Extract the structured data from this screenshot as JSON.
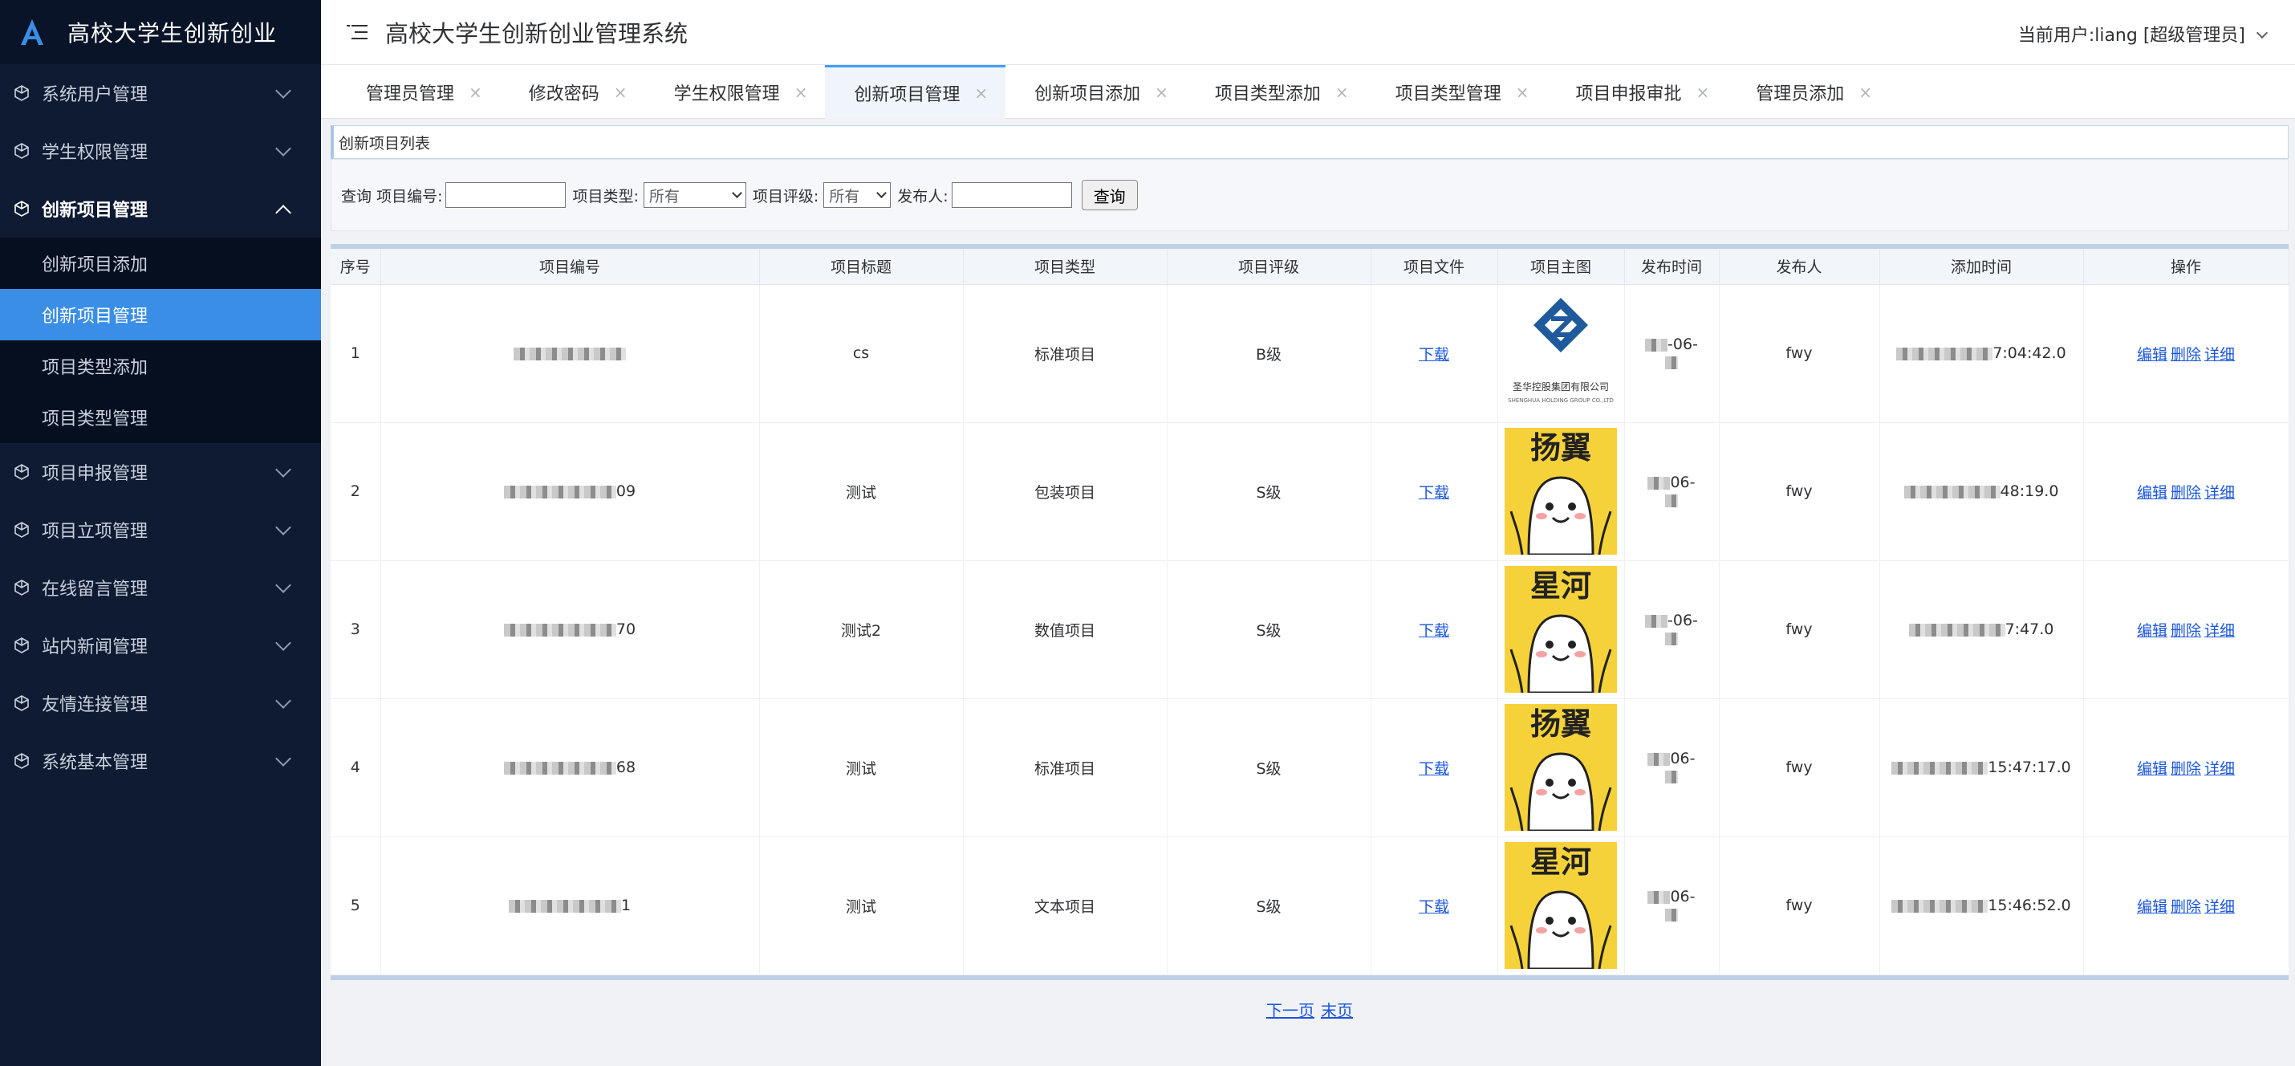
{
  "app": {
    "title": "高校大学生创新创业",
    "system_title": "高校大学生创新创业管理系统"
  },
  "user": {
    "label": "当前用户:liang [超级管理员]"
  },
  "sidebar": {
    "items": [
      {
        "label": "系统用户管理"
      },
      {
        "label": "学生权限管理"
      },
      {
        "label": "创新项目管理",
        "open": true,
        "children": [
          {
            "label": "创新项目添加"
          },
          {
            "label": "创新项目管理",
            "active": true
          },
          {
            "label": "项目类型添加"
          },
          {
            "label": "项目类型管理"
          }
        ]
      },
      {
        "label": "项目申报管理"
      },
      {
        "label": "项目立项管理"
      },
      {
        "label": "在线留言管理"
      },
      {
        "label": "站内新闻管理"
      },
      {
        "label": "友情连接管理"
      },
      {
        "label": "系统基本管理"
      }
    ]
  },
  "tabs": [
    {
      "label": "管理员管理"
    },
    {
      "label": "修改密码"
    },
    {
      "label": "学生权限管理"
    },
    {
      "label": "创新项目管理",
      "active": true
    },
    {
      "label": "创新项目添加"
    },
    {
      "label": "项目类型添加"
    },
    {
      "label": "项目类型管理"
    },
    {
      "label": "项目申报审批"
    },
    {
      "label": "管理员添加"
    }
  ],
  "tab_close": "×",
  "panel": {
    "title": "创新项目列表"
  },
  "search": {
    "prefix": "查询",
    "code_label": "项目编号:",
    "type_label": "项目类型:",
    "type_value": "所有",
    "grade_label": "项目评级:",
    "grade_value": "所有",
    "publisher_label": "发布人:",
    "button": "查询"
  },
  "table": {
    "headers": [
      "序号",
      "项目编号",
      "项目标题",
      "项目类型",
      "项目评级",
      "项目文件",
      "项目主图",
      "发布时间",
      "发布人",
      "添加时间",
      "操作"
    ],
    "rows": [
      {
        "no": "1",
        "code_tail": "",
        "title": "cs",
        "type": "标准项目",
        "grade": "B级",
        "file": "下载",
        "image": "logo",
        "pub_date": "-06-",
        "publisher": "fwy",
        "added_tail": "7:04:42.0"
      },
      {
        "no": "2",
        "code_tail": "09",
        "title": "测试",
        "type": "包装项目",
        "grade": "S级",
        "file": "下载",
        "image": "扬翼",
        "pub_date": "06-",
        "publisher": "fwy",
        "added_tail": "48:19.0"
      },
      {
        "no": "3",
        "code_tail": "70",
        "title": "测试2",
        "type": "数值项目",
        "grade": "S级",
        "file": "下载",
        "image": "星河",
        "pub_date": "-06-",
        "publisher": "fwy",
        "added_tail": "7:47.0"
      },
      {
        "no": "4",
        "code_tail": "68",
        "title": "测试",
        "type": "标准项目",
        "grade": "S级",
        "file": "下载",
        "image": "扬翼",
        "pub_date": "06-",
        "publisher": "fwy",
        "added_tail": "15:47:17.0"
      },
      {
        "no": "5",
        "code_tail": "1",
        "title": "测试",
        "type": "文本项目",
        "grade": "S级",
        "file": "下载",
        "image": "星河",
        "pub_date": "06-",
        "publisher": "fwy",
        "added_tail": "15:46:52.0"
      }
    ],
    "ops": {
      "edit": "编辑",
      "delete": "删除",
      "detail": "详细"
    }
  },
  "logo_caption": "圣华控股集团有限公司",
  "pager": {
    "next": "下一页",
    "last": "末页"
  },
  "colors": {
    "sidebar": "#0f1b33",
    "active": "#3a8ee6",
    "link": "#1a56db"
  }
}
